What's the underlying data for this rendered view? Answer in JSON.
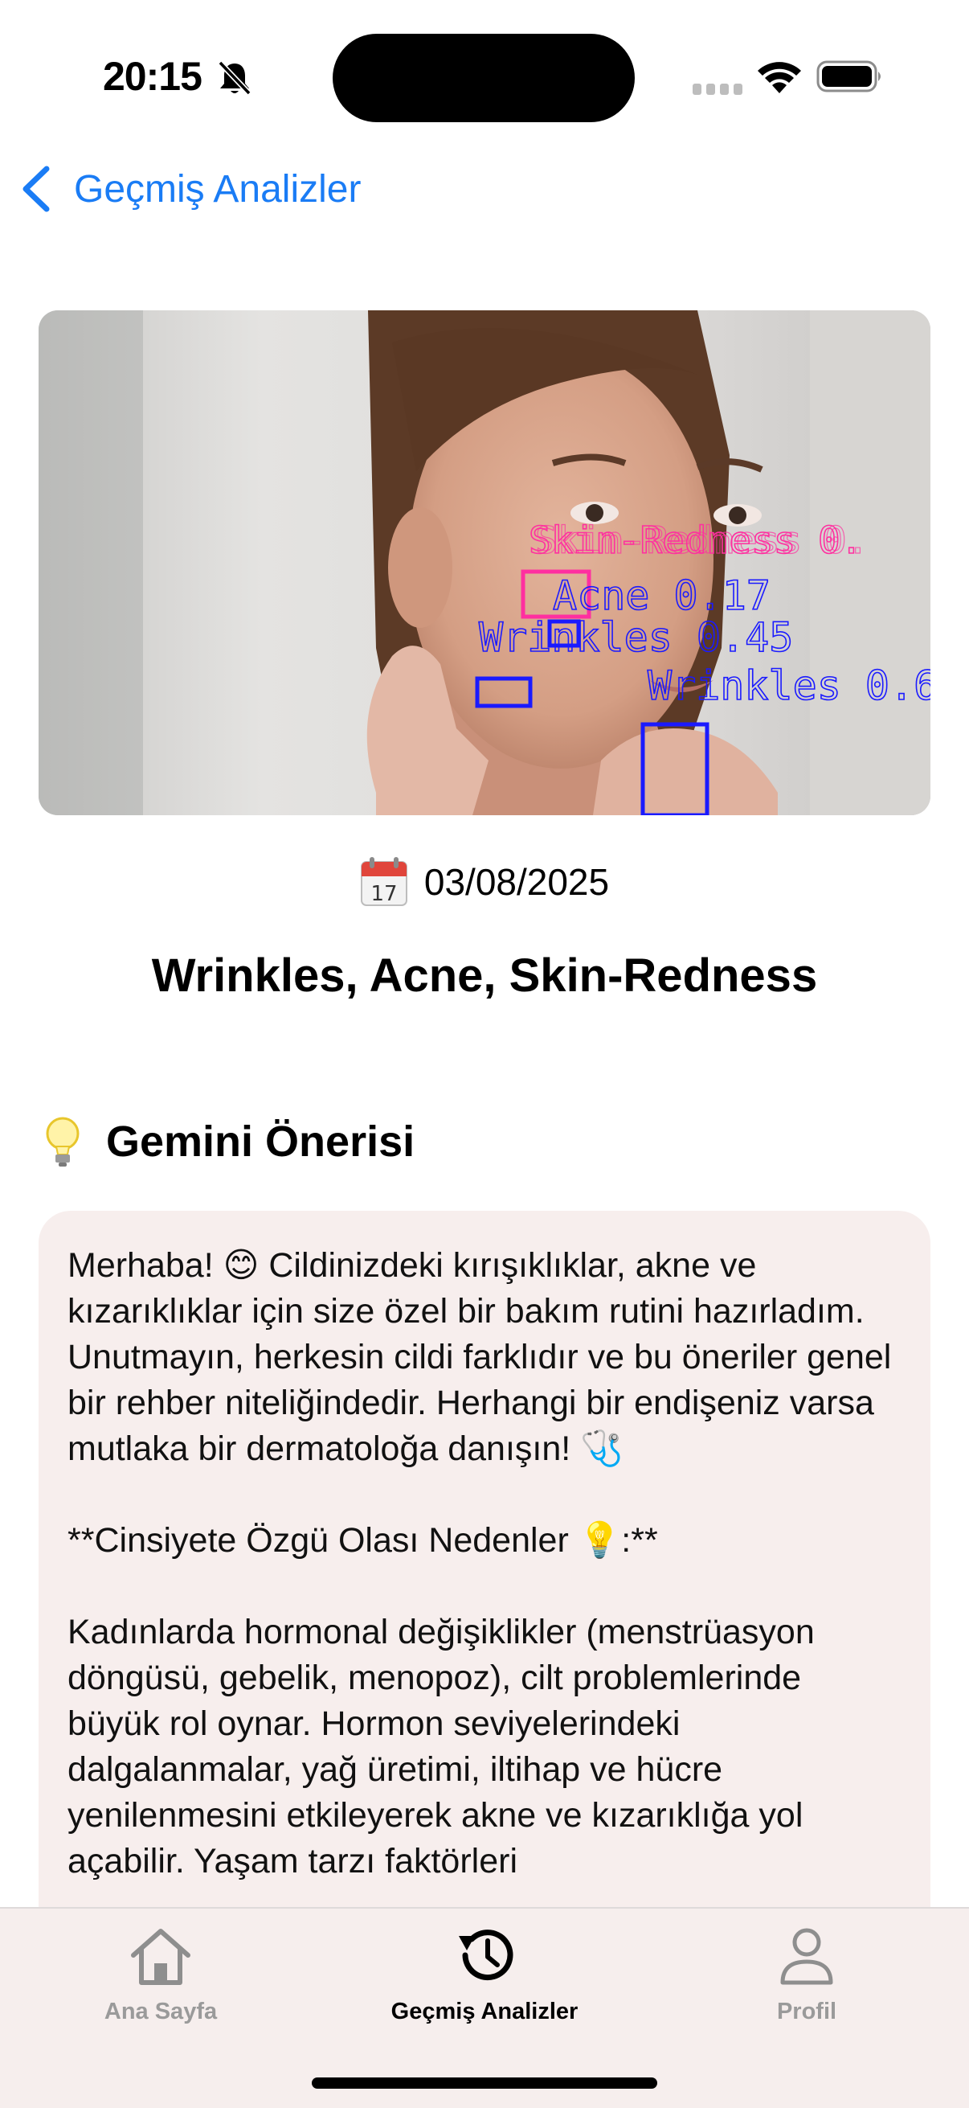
{
  "status": {
    "time": "20:15"
  },
  "nav": {
    "back_label": "Geçmiş Analizler"
  },
  "photo": {
    "detections": [
      {
        "label": "Skin-Redness 0.",
        "color": "#ff2fa0"
      },
      {
        "label": "Acne 0.17",
        "color": "#1a1aff"
      },
      {
        "label": "Wrinkles 0.45",
        "color": "#1a1aff"
      },
      {
        "label": "Wrinkles 0.6",
        "color": "#1a1aff"
      }
    ]
  },
  "analysis": {
    "date": "03/08/2025",
    "title": "Wrinkles, Acne, Skin-Redness"
  },
  "gemini": {
    "section_title": "Gemini Önerisi",
    "paragraph1": "Merhaba! 😊 Cildinizdeki kırışıklıklar, akne ve kızarıklıklar için size özel bir bakım rutini hazırladım. Unutmayın, herkesin cildi farklıdır ve bu öneriler genel bir rehber niteliğindedir. Herhangi bir endişeniz varsa mutlaka bir dermatoloğa danışın! 🩺",
    "paragraph2": "**Cinsiyete Özgü Olası Nedenler 💡:**",
    "paragraph3": "Kadınlarda hormonal değişiklikler (menstrüasyon döngüsü, gebelik, menopoz), cilt problemlerinde büyük rol oynar. Hormon seviyelerindeki dalgalanmalar, yağ üretimi, iltihap ve hücre yenilenmesini etkileyerek akne ve kızarıklığa yol açabilir. Yaşam tarzı faktörleri"
  },
  "tabs": [
    {
      "label": "Ana Sayfa",
      "icon": "house-icon",
      "active": false
    },
    {
      "label": "Geçmiş Analizler",
      "icon": "history-icon",
      "active": true
    },
    {
      "label": "Profil",
      "icon": "person-icon",
      "active": false
    }
  ]
}
